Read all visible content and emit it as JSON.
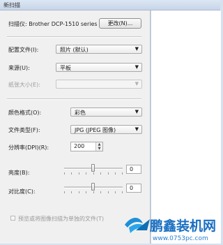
{
  "window": {
    "title": "新扫描"
  },
  "scanner": {
    "label": "扫描仪: Brother DCP-1510 series",
    "change_button": "更改(N)..."
  },
  "profile": {
    "label": "配置文件(I):",
    "value": "照片 (默认)"
  },
  "source": {
    "label": "来源(U):",
    "value": "平板"
  },
  "paper_size": {
    "label": "纸张大小(E):",
    "value": ""
  },
  "color_format": {
    "label": "颜色格式(O):",
    "value": "彩色"
  },
  "file_type": {
    "label": "文件类型(F):",
    "value": "JPG (JPEG 图像)"
  },
  "resolution": {
    "label": "分辨率(DPI)(R):",
    "value": "200"
  },
  "brightness": {
    "label": "亮度(B):",
    "value": "0"
  },
  "contrast": {
    "label": "对比度(C):",
    "value": "0"
  },
  "preview_option": {
    "label": "预览或将图像扫描为单独的文件(T)",
    "checked": false
  },
  "watermark": {
    "brand": "鹏鑫装机网",
    "url": "www.0753pc.com"
  },
  "icons": {
    "dropdown": "chevron-down-icon",
    "spin_up": "spin-up-icon",
    "spin_down": "spin-down-icon",
    "logo": "bird-logo-icon"
  }
}
